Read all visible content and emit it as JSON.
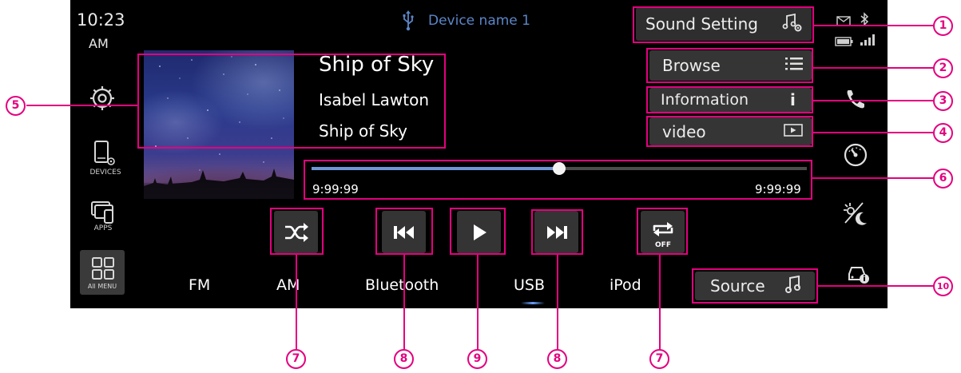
{
  "status_bar": {
    "time": "10:23",
    "ampm": "AM",
    "device_name": "Device name 1"
  },
  "left_menu": {
    "devices_label": "DEVICES",
    "apps_label": "APPS",
    "all_menu_label": "All MENU"
  },
  "track": {
    "title": "Ship of Sky",
    "artist": "Isabel Lawton",
    "album": "Ship of Sky"
  },
  "buttons": {
    "sound_setting": "Sound Setting",
    "browse": "Browse",
    "information": "Information",
    "info_glyph": "i",
    "video": "video",
    "source": "Source"
  },
  "progress": {
    "elapsed": "9:99:99",
    "total": "9:99:99",
    "fraction": 0.5
  },
  "repeat_state": "OFF",
  "sources": [
    "FM",
    "AM",
    "Bluetooth",
    "USB",
    "iPod"
  ],
  "active_source": "USB",
  "callouts": [
    "1",
    "2",
    "3",
    "4",
    "5",
    "6",
    "7",
    "8",
    "9",
    "8",
    "7",
    "10"
  ],
  "colors": {
    "accent_blue": "#5b86c8",
    "annotation_pink": "#e4007f",
    "button_bg": "#353535"
  }
}
